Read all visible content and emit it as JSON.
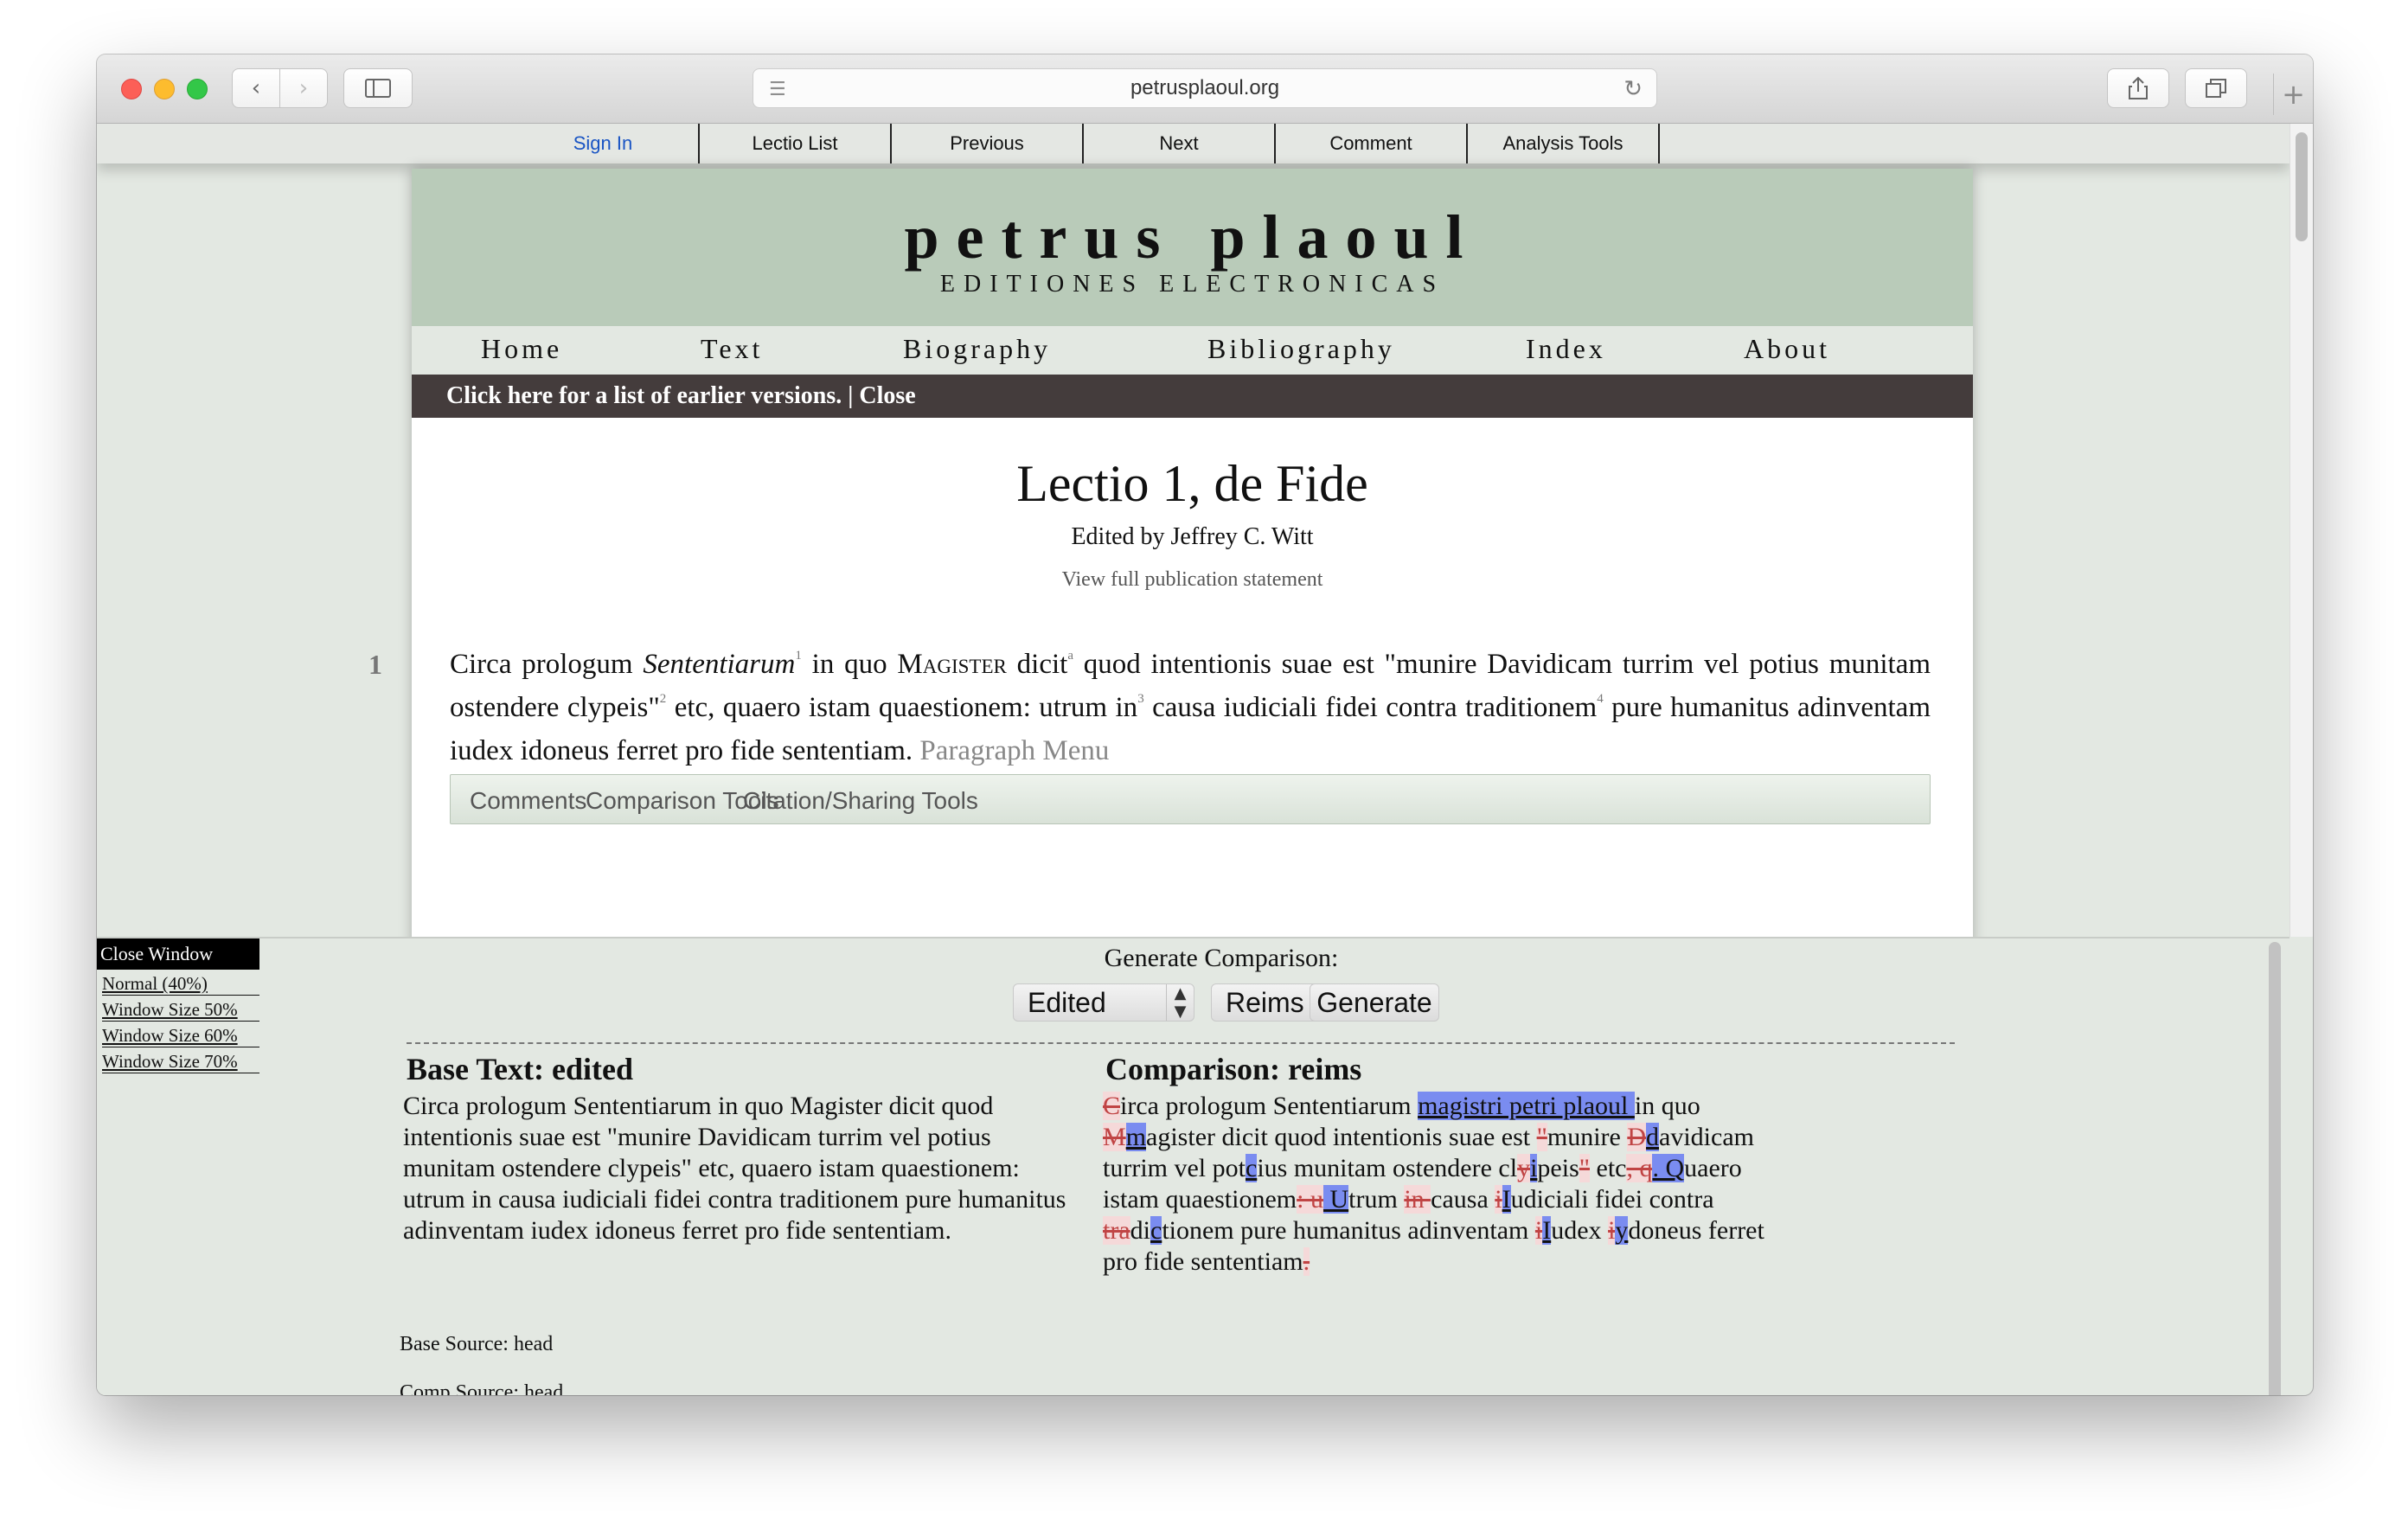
{
  "browser": {
    "url": "petrusplaoul.org"
  },
  "topnav": {
    "items": [
      "Sign In",
      "Lectio List",
      "Previous",
      "Next",
      "Comment",
      "Analysis Tools"
    ]
  },
  "site": {
    "title": "petrus plaoul",
    "subtitle": "EDITIONES ELECTRONICAS",
    "nav": [
      "Home",
      "Text",
      "Biography",
      "Bibliography",
      "Index",
      "About"
    ],
    "banner": "Click here for a list of earlier versions. | Close"
  },
  "lectio": {
    "title": "Lectio 1, de Fide",
    "editor": "Edited by Jeffrey C. Witt",
    "publication_link": "View full publication statement",
    "paragraph_number": "1",
    "para": {
      "t1": "Circa prologum ",
      "t2": "Sententiarum",
      "n1": "1",
      "t3": " in quo ",
      "t4": "Magister",
      "t5": " dicit",
      "n2": "a",
      "t6": " quod intentionis suae est \"munire Davidicam turrim vel potius munitam ostendere clypeis\"",
      "n3": "2",
      "t7": " etc, quaero istam quaestionem: utrum in",
      "n4": "3",
      "t8": " causa iudiciali fidei contra traditionem",
      "n5": "4",
      "t9": " pure humanitus adinventam iudex idoneus ferret pro fide sententiam. ",
      "menu": "Paragraph Menu"
    },
    "para_tabs": [
      "Comments",
      "Comparison Tools",
      "Citation/Sharing Tools"
    ]
  },
  "compare": {
    "close": "Close Window",
    "sizes": [
      "Normal (40%)",
      "Window Size 50%",
      "Window Size 60%",
      "Window Size 70%"
    ],
    "generate_label": "Generate Comparison:",
    "base_select": "Edited",
    "comp_select": "Reims",
    "generate_button": "Generate",
    "base_heading": "Base Text: edited",
    "base_text": "Circa prologum Sententiarum in quo Magister dicit quod intentionis suae est \"munire Davidicam turrim vel potius munitam ostendere clypeis\" etc, quaero istam quaestionem: utrum in causa iudiciali fidei contra traditionem pure humanitus adinventam iudex idoneus ferret pro fide sententiam.",
    "comp_heading": "Comparison: reims",
    "comp": {
      "a1": "C",
      "a2": "irca prologum Sententiarum ",
      "a3": "magistri petri plaoul ",
      "a4": "in quo ",
      "a5": "M",
      "a6": "m",
      "a7": "agister dicit quod intentionis suae est ",
      "a8": "\"",
      "a9": "munire ",
      "a10": "D",
      "a11": "d",
      "a12": "avidicam turrim vel pot",
      "a13": "c",
      "a14": "ius munitam ostendere cl",
      "a15": "y",
      "a16": "i",
      "a17": "peis",
      "a18": "\"",
      "a19": " etc",
      "a20": ", q",
      "a21": ". Q",
      "a22": "uaero istam quaestionem",
      "a23": ": u",
      "a24": " U",
      "a25": "trum ",
      "a26": "in ",
      "a27": "causa ",
      "a28": "i",
      "a29": "I",
      "a30": "udiciali fidei contra",
      "a31": " tra",
      "a32": "di",
      "a33": "c",
      "a34": "tionem pure humanitus adinventam ",
      "a35": "i",
      "a36": "I",
      "a37": "udex ",
      "a38": "i",
      "a39": "y",
      "a40": "doneus ferret pro fide sententiam",
      "a41": "."
    },
    "base_source": "Base Source: head",
    "comp_source": "Comp Source: head"
  },
  "colors": {
    "masthead": "#b9cbb9",
    "banner": "#443c3c",
    "insertion_highlight": "#7a8cf0",
    "deletion": "#c04444",
    "sign_in_link": "#1a55c4"
  },
  "icons": [
    "back-icon",
    "forward-icon",
    "sidebar-icon",
    "reader-icon",
    "reload-icon",
    "share-icon",
    "tabs-icon",
    "new-tab-icon"
  ]
}
